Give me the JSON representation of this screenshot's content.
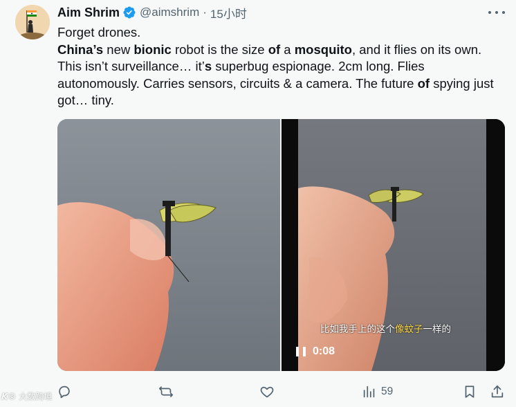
{
  "author": {
    "name": "Aim Shrim",
    "handle": "@aimshrim",
    "separator": "·",
    "time": "15小时"
  },
  "tweet": {
    "line1": "Forget drones.",
    "seg_china": "China",
    "seg_china_rest": "’s",
    "seg_new": " new ",
    "seg_bionic": "bionic",
    "seg_robot": " robot is the size ",
    "seg_of1": "of",
    "seg_a": " a ",
    "seg_mosquito": "mosquito",
    "seg_flies": ", and it flies on its own. This isn’t surveillance… it’",
    "seg_s": "s",
    "seg_rest": " superbug espionage. 2cm long. Flies autonomously. Carries sensors, circuits & a camera. The future ",
    "seg_of2": "of",
    "seg_end": " spying just got… tiny."
  },
  "video": {
    "subtitle_pre": "比如我手上的这个",
    "subtitle_hl": "像蚊子",
    "subtitle_post": "一样的",
    "time": "0:08",
    "pause_icon": "pause-icon"
  },
  "actions": {
    "reply_icon": "reply-icon",
    "repost_icon": "repost-icon",
    "like_icon": "heart-icon",
    "views_icon": "views-chart-icon",
    "views_count": "59",
    "bookmark_icon": "bookmark-icon",
    "share_icon": "share-icon"
  },
  "watermark": {
    "logo": "K©",
    "text": "大数跨境"
  },
  "colors": {
    "verified": "#1d9bf0",
    "muted": "#536471",
    "text": "#0f1419",
    "subtitle_highlight": "#ffd84a"
  }
}
